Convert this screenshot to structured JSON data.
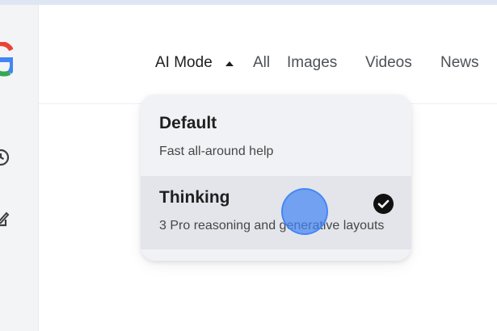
{
  "tabs": {
    "ai_mode": "AI Mode",
    "all": "All",
    "images": "Images",
    "videos": "Videos",
    "news": "News"
  },
  "dropdown": {
    "options": [
      {
        "title": "Default",
        "description": "Fast all-around help",
        "selected": false
      },
      {
        "title": "Thinking",
        "description": "3 Pro reasoning and generative layouts",
        "selected": true
      }
    ]
  },
  "icons": {
    "logo": "google-g-logo-icon",
    "rail_1": "history-icon",
    "rail_2": "edit-icon",
    "selected": "check-circle-icon",
    "tab_caret": "caret-up-icon"
  },
  "colors": {
    "accent_blue": "#4285F4",
    "selected_row": "#E3E5EB",
    "menu_bg": "#F1F2F5",
    "text_primary": "#1F1F1F"
  }
}
